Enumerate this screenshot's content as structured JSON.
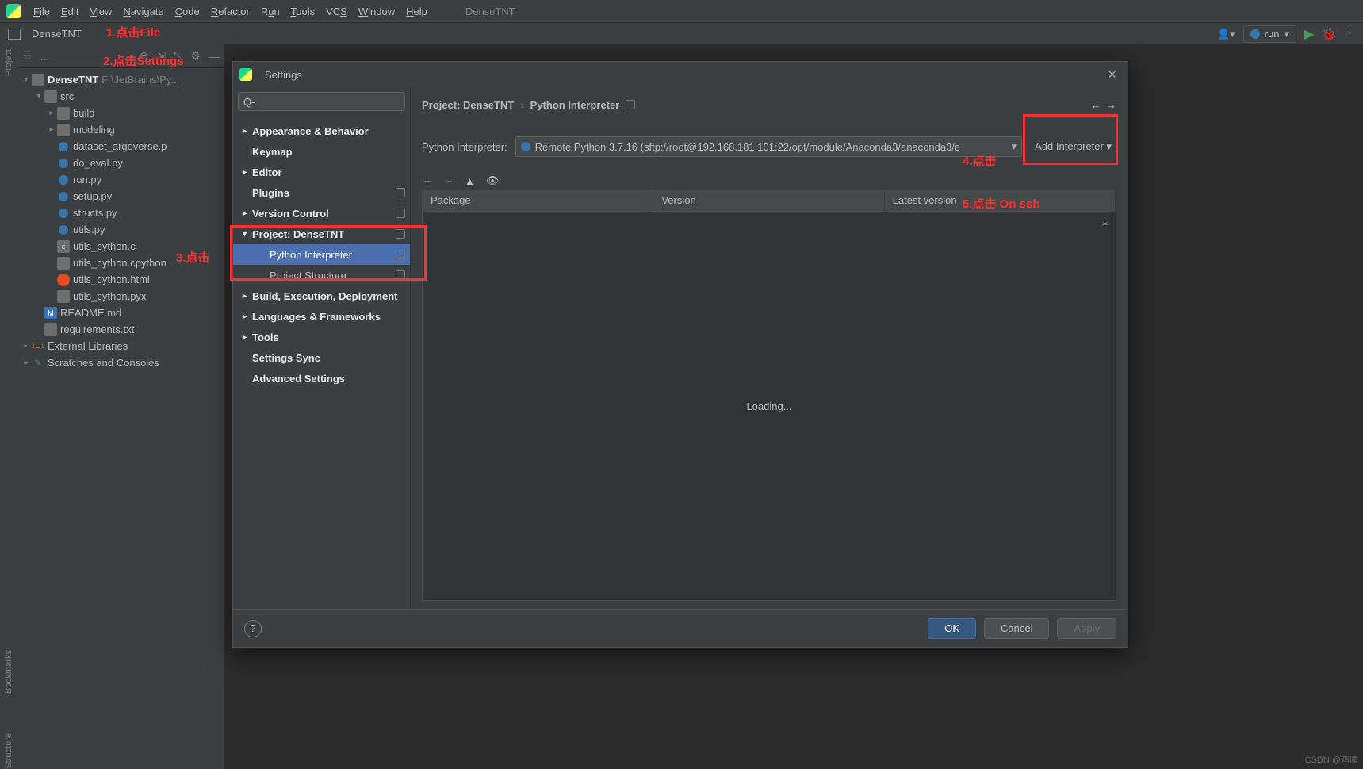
{
  "app_title": "DenseTNT",
  "menubar": [
    "File",
    "Edit",
    "View",
    "Navigate",
    "Code",
    "Refactor",
    "Run",
    "Tools",
    "VCS",
    "Window",
    "Help"
  ],
  "toolbar": {
    "project_crumb": "DenseTNT",
    "run_config": "run"
  },
  "side_rail_top": "Project",
  "side_rail_bottom": [
    "Bookmarks",
    "Structure"
  ],
  "project_panel": {
    "toolhead": "...",
    "root": {
      "name": "DenseTNT",
      "path": "F:\\JetBrains\\Py..."
    },
    "src": "src",
    "build": "build",
    "modeling": "modeling",
    "files": [
      "dataset_argoverse.p",
      "do_eval.py",
      "run.py",
      "setup.py",
      "structs.py",
      "utils.py",
      "utils_cython.c",
      "utils_cython.cpython",
      "utils_cython.html",
      "utils_cython.pyx"
    ],
    "root_files": [
      "README.md",
      "requirements.txt"
    ],
    "ext_lib": "External Libraries",
    "scratches": "Scratches and Consoles"
  },
  "dialog": {
    "title": "Settings",
    "search_placeholder": "Q-",
    "nav": [
      {
        "label": "Appearance & Behavior",
        "bold": true,
        "arrow": ">"
      },
      {
        "label": "Keymap",
        "bold": true
      },
      {
        "label": "Editor",
        "bold": true,
        "arrow": ">"
      },
      {
        "label": "Plugins",
        "bold": true,
        "marker": true
      },
      {
        "label": "Version Control",
        "bold": true,
        "arrow": ">",
        "marker": true
      },
      {
        "label": "Project: DenseTNT",
        "bold": true,
        "arrow": "v",
        "marker": true
      },
      {
        "label": "Python Interpreter",
        "sub": true,
        "sel": true,
        "marker": true
      },
      {
        "label": "Project Structure",
        "sub": true,
        "marker": true
      },
      {
        "label": "Build, Execution, Deployment",
        "bold": true,
        "arrow": ">"
      },
      {
        "label": "Languages & Frameworks",
        "bold": true,
        "arrow": ">"
      },
      {
        "label": "Tools",
        "bold": true,
        "arrow": ">"
      },
      {
        "label": "Settings Sync",
        "bold": true
      },
      {
        "label": "Advanced Settings",
        "bold": true
      }
    ],
    "crumb_project": "Project: DenseTNT",
    "crumb_page": "Python Interpreter",
    "interp_label": "Python Interpreter:",
    "interp_value": "Remote Python 3.7.16 (sftp://root@192.168.181.101:22/opt/module/Anaconda3/anaconda3/e",
    "add_interp": "Add Interpreter",
    "pkg_cols": [
      "Package",
      "Version",
      "Latest version"
    ],
    "loading": "Loading...",
    "buttons": {
      "ok": "OK",
      "cancel": "Cancel",
      "apply": "Apply"
    }
  },
  "annotations": {
    "a1": "1.点击File",
    "a2": "2.点击Settings",
    "a3": "3.点击",
    "a4": "4.点击",
    "a5": "5.点击 On ssh"
  },
  "watermark": "CSDN @鸡康"
}
